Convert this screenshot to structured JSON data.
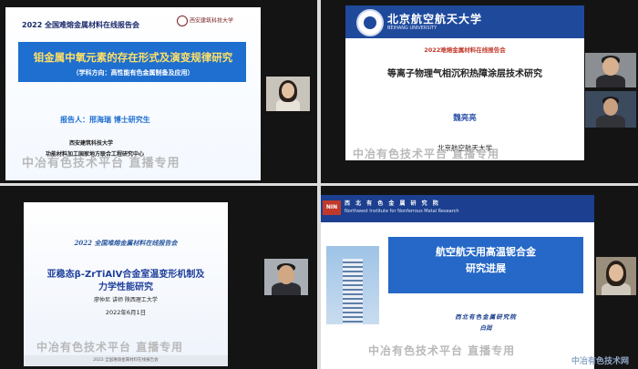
{
  "panels": {
    "q1": {
      "title": "2022 全国难熔金属材料在线报告会",
      "logo_text": "西安建筑科技大学",
      "main": "钼金属中氧元素的存在形式及演变规律研究",
      "sub": "（学科方向：高性能有色金属制备及应用）",
      "reporter": "报告人：邢海瑞  博士研究生",
      "org1": "西安建筑科技大学",
      "org2": "功能材料加工国家地方联合工程研究中心",
      "watermark": "中冶有色技术平台   直播专用"
    },
    "q2": {
      "univ": "北京航空航天大学",
      "univ_en": "BEIHANG UNIVERSITY",
      "title": "2022难熔金属材料在线报告会",
      "main": "等离子物理气相沉积热障涂层技术研究",
      "name": "魏亮亮",
      "org": "北京航空航天大学",
      "watermark": "中冶有色技术平台   直播专用"
    },
    "q3": {
      "title": "2022 全国难熔金属材料在线报告会",
      "main1": "亚稳态β-ZrTiAlV合金室温变形机制及",
      "main2": "力学性能研究",
      "speaker": "廖仲尼  讲师  陕西理工大学",
      "date": "2022年6月1日",
      "footer": "2022 全国难熔金属材料在线报告会",
      "watermark": "中冶有色技术平台   直播专用"
    },
    "q4": {
      "logo": "NIN",
      "univ": "西 北 有 色 金 属 研 究 院",
      "univ_en": "Northwest Institute for Nonferrous Metal Research",
      "main1": "航空航天用高温铌合金",
      "main2": "研究进展",
      "org": "西北有色金属研究院",
      "name": "白润",
      "watermark": "中冶有色技术平台   直播专用"
    }
  },
  "site_watermark": "中冶有色技术网"
}
